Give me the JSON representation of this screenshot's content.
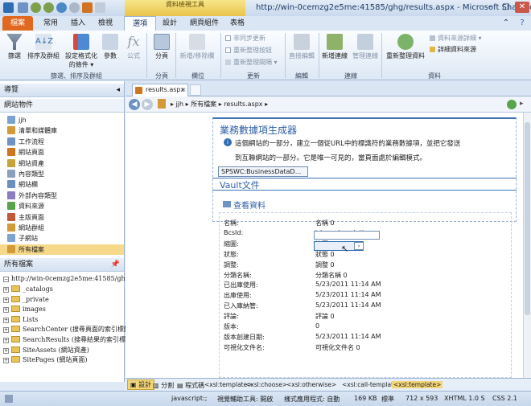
{
  "titlebar": {
    "context_tab_label": "資料檢視工具",
    "title": "http://win-0cemzg2e5me:41585/ghg/results.aspx - Microsoft SharePoint ..."
  },
  "tabs": {
    "file": "檔案",
    "home": "常用",
    "insert": "插入",
    "view": "檢視",
    "options": "選項",
    "design": "設計",
    "web_part": "網頁組件",
    "table": "表格"
  },
  "ribbon": {
    "filter": "篩選",
    "sort_group": "排序及群組",
    "cond_format": "設定格式化",
    "cond_format2": "的條件",
    "params": "參數",
    "formula": "公式",
    "paging": "分頁",
    "add_remove_cols": "新增/移除欄",
    "async_update": "非同步更新",
    "refresh_btn": "重新整理按鈕",
    "refresh_interval": "重新整理間隔",
    "inline_edit": "直接編輯",
    "add_conn": "新增連線",
    "manage_conn": "管理連線",
    "refresh_data": "重新整理資料",
    "data_source_details": "資料來源詳細",
    "data_source_details2": "詳細資料來源",
    "groups": {
      "filter_sort": "篩選、排序及群組",
      "paging": "分頁",
      "fields": "欄位",
      "update": "更新",
      "edit": "編輯",
      "connections": "連線",
      "data": "資料"
    }
  },
  "nav": {
    "header": "導覽",
    "site_objects_header": "網站物件",
    "site_objects": [
      "jjh",
      "清單和媒體庫",
      "工作流程",
      "網站頁面",
      "網站資產",
      "內容類型",
      "網站欄",
      "外部內容類型",
      "資料來源",
      "主版頁面",
      "網站群組",
      "子網站",
      "所有檔案"
    ],
    "all_files_header": "所有檔案",
    "tree_root": "http://win-0cemzg2e5me:41585/ghg",
    "tree": [
      "_catalogs",
      "_private",
      "images",
      "Lists",
      "SearchCenter (搜尋頁面的索引標籤)",
      "SearchResults (搜尋結果的索引標籤)",
      "SiteAssets (網站資產)",
      "SitePages (網站頁面)"
    ]
  },
  "doc": {
    "tab": "results.aspx",
    "breadcrumb_site": "jjh",
    "breadcrumb_all": "所有檔案",
    "breadcrumb_page": "results.aspx"
  },
  "content": {
    "heading": "業務數據項生成器",
    "info_line1": "這個網站的一部分，建立一個從URL中的標識符的業務數據項，並把它發送",
    "info_line2": "到互聯網站的一部分。它是唯一可見的，當頁面處於編輯模式。",
    "webpart_tag": "SPSWC:BusinessDataD...",
    "section_title": "Vault文件",
    "view_link": "查看資料",
    "fields": [
      {
        "label": "名稱:",
        "value": "名稱 0"
      },
      {
        "label": "BcsId:",
        "value": "td.ms-descriptio..."
      },
      {
        "label": "縮圖:",
        "value": "縮圖 0"
      },
      {
        "label": "狀態:",
        "value": "狀態 0"
      },
      {
        "label": "調整:",
        "value": "調整 0"
      },
      {
        "label": "分類名稱:",
        "value": "分類名稱 0"
      },
      {
        "label": "已出庫使用:",
        "value": "5/23/2011 11:14 AM"
      },
      {
        "label": "出庫使用:",
        "value": "5/23/2011 11:14 AM"
      },
      {
        "label": "已入庫納管:",
        "value": "5/23/2011 11:14 AM"
      },
      {
        "label": "評論:",
        "value": "評論 0"
      },
      {
        "label": "版本:",
        "value": "0"
      },
      {
        "label": "版本創建日期:",
        "value": "5/23/2011 11:14 AM"
      },
      {
        "label": "可視化文件名:",
        "value": "可視化文件名 0"
      }
    ]
  },
  "viewbar": {
    "design": "設計",
    "split": "分割",
    "code": "程式碼",
    "crumbs": [
      "<xsl:template>",
      "<xsl:choose>",
      "<xsl:otherwise>",
      "<xsl:call-template>",
      "<xsl:template>"
    ]
  },
  "status": {
    "js": "javascript:;",
    "visual_aid": "視覺輔助工具: 開啟",
    "style_mode": "樣式應用程式: 自動",
    "size": "169 KB",
    "standard": "標準",
    "dims": "712 x 593",
    "xhtml": "XHTML 1.0 S",
    "css": "CSS 2.1"
  }
}
